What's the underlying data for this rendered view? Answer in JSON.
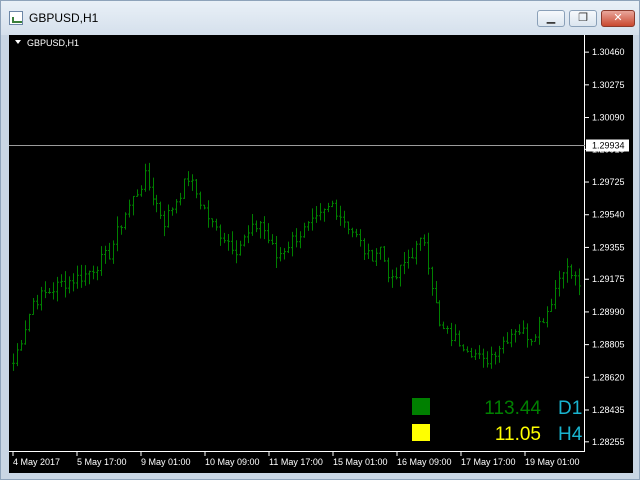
{
  "window": {
    "title": "GBPUSD,H1",
    "minimize_glyph": "▁",
    "restore_glyph": "❐",
    "close_glyph": "✕"
  },
  "chart": {
    "label": "GBPUSD,H1",
    "current_price": "1.29934"
  },
  "indicator": {
    "rows": [
      {
        "value": "113.44",
        "timeframe": "D1",
        "swatch_color": "#008000",
        "value_color": "#008000"
      },
      {
        "value": "11.05",
        "timeframe": "H4",
        "swatch_color": "#ffff00",
        "value_color": "#ffff00"
      }
    ],
    "timeframe_color": "#19b4cf"
  },
  "colors": {
    "bars": "#008000",
    "axis": "#ffffff",
    "price_line": "#9b9b9b"
  },
  "chart_data": {
    "type": "bar",
    "symbol": "GBPUSD",
    "timeframe": "H1",
    "y_ticks": [
      "1.30460",
      "1.30275",
      "1.30090",
      "1.29910",
      "1.29725",
      "1.29540",
      "1.29355",
      "1.29175",
      "1.28990",
      "1.28805",
      "1.28620",
      "1.28435",
      "1.28255"
    ],
    "y_tick_values": [
      1.3046,
      1.30275,
      1.3009,
      1.2991,
      1.29725,
      1.2954,
      1.29355,
      1.29175,
      1.2899,
      1.28805,
      1.2862,
      1.28435,
      1.28255
    ],
    "ylim": [
      1.2822,
      1.3054
    ],
    "x_ticks": [
      "4 May 2017",
      "5 May 17:00",
      "9 May 01:00",
      "10 May 09:00",
      "11 May 17:00",
      "15 May 01:00",
      "16 May 09:00",
      "17 May 17:00",
      "19 May 01:00"
    ],
    "current_price": 1.29934,
    "bars_count": 143,
    "close_waypoints": [
      [
        0,
        1.287
      ],
      [
        5,
        1.2905
      ],
      [
        12,
        1.2915
      ],
      [
        18,
        1.292
      ],
      [
        24,
        1.2932
      ],
      [
        28,
        1.2955
      ],
      [
        33,
        1.2975
      ],
      [
        38,
        1.295
      ],
      [
        44,
        1.2975
      ],
      [
        50,
        1.2948
      ],
      [
        56,
        1.2935
      ],
      [
        62,
        1.295
      ],
      [
        66,
        1.293
      ],
      [
        70,
        1.294
      ],
      [
        76,
        1.295
      ],
      [
        80,
        1.296
      ],
      [
        85,
        1.2945
      ],
      [
        89,
        1.293
      ],
      [
        92,
        1.2935
      ],
      [
        95,
        1.2915
      ],
      [
        99,
        1.293
      ],
      [
        103,
        1.294
      ],
      [
        107,
        1.289
      ],
      [
        110,
        1.2885
      ],
      [
        114,
        1.288
      ],
      [
        118,
        1.287
      ],
      [
        122,
        1.288
      ],
      [
        126,
        1.289
      ],
      [
        130,
        1.2885
      ],
      [
        134,
        1.29
      ],
      [
        138,
        1.2925
      ],
      [
        142,
        1.2915
      ]
    ]
  }
}
